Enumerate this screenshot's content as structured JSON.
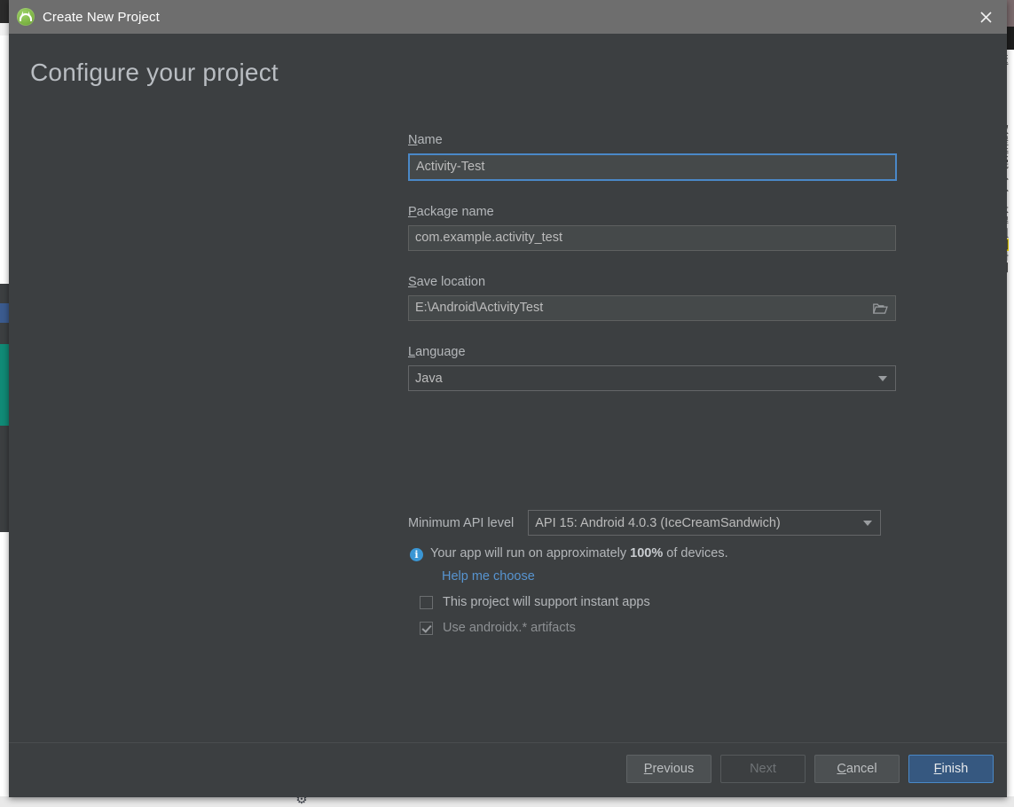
{
  "window": {
    "title": "Create New Project",
    "app_icon": "android-studio-icon",
    "close_icon": "close-icon"
  },
  "page": {
    "heading": "Configure your project"
  },
  "form": {
    "name": {
      "label": "Name",
      "mnemonic": "N",
      "value": "Activity-Test",
      "focused": true
    },
    "package_name": {
      "label": "Package name",
      "mnemonic": "P",
      "value": "com.example.activity_test"
    },
    "save_location": {
      "label": "Save location",
      "mnemonic": "S",
      "value": "E:\\Android\\ActivityTest",
      "browse_icon": "folder-icon"
    },
    "language": {
      "label": "Language",
      "mnemonic": "L",
      "value": "Java",
      "caret_icon": "chevron-down-icon"
    },
    "minimum_api": {
      "label": "Minimum API level",
      "value": "API 15: Android 4.0.3 (IceCreamSandwich)",
      "caret_icon": "chevron-down-icon"
    },
    "info": {
      "icon": "info-icon",
      "text_before": "Your app will run on approximately ",
      "percent": "100%",
      "text_after": " of devices.",
      "link": "Help me choose"
    },
    "checkboxes": [
      {
        "label": "This project will support instant apps",
        "checked": false,
        "disabled": false
      },
      {
        "label": "Use androidx.* artifacts",
        "checked": true,
        "disabled": true
      }
    ]
  },
  "footer": {
    "buttons": [
      {
        "label": "Previous",
        "mnemonic": "P",
        "state": "normal"
      },
      {
        "label": "Next",
        "mnemonic": "N",
        "state": "disabled"
      },
      {
        "label": "Cancel",
        "mnemonic": "C",
        "state": "normal"
      },
      {
        "label": "Finish",
        "mnemonic": "F",
        "state": "primary"
      }
    ]
  },
  "colors": {
    "dialog_bg": "#3c3f41",
    "titlebar_bg": "#6e6e6e",
    "accent_blue": "#4a88c7",
    "primary_button": "#365880",
    "link_blue": "#5794d0",
    "info_blue": "#3a96d4",
    "text": "#b4b7ba",
    "heading": "#b9bdc2"
  },
  "background": {
    "right_edge_text": [
      "返",
      "取",
      "提",
      "接",
      "完",
      "入",
      "入",
      "本",
      "得",
      "粗",
      "词",
      "册",
      "门"
    ]
  }
}
